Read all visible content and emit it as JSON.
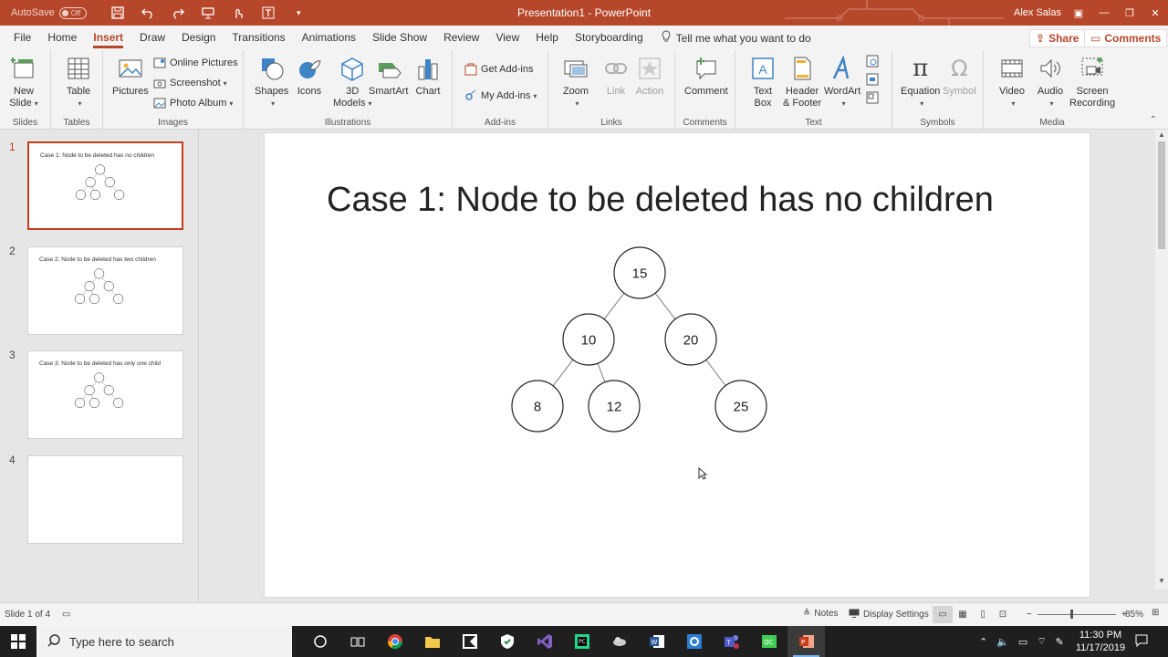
{
  "titlebar": {
    "autosave_label": "AutoSave",
    "autosave_state": "Off",
    "document_title": "Presentation1  -  PowerPoint",
    "user_name": "Alex Salas"
  },
  "tabs": [
    "File",
    "Home",
    "Insert",
    "Draw",
    "Design",
    "Transitions",
    "Animations",
    "Slide Show",
    "Review",
    "View",
    "Help",
    "Storyboarding"
  ],
  "active_tab": "Insert",
  "tell_me": "Tell me what you want to do",
  "share_label": "Share",
  "comments_label": "Comments",
  "ribbon": {
    "slides": {
      "label": "Slides",
      "new_slide_1": "New",
      "new_slide_2": "Slide"
    },
    "tables": {
      "label": "Tables",
      "table": "Table"
    },
    "images": {
      "label": "Images",
      "pictures": "Pictures",
      "online_pictures": "Online Pictures",
      "screenshot": "Screenshot",
      "photo_album": "Photo Album"
    },
    "illustrations": {
      "label": "Illustrations",
      "shapes": "Shapes",
      "icons": "Icons",
      "models_1": "3D",
      "models_2": "Models",
      "smartart": "SmartArt",
      "chart": "Chart"
    },
    "addins": {
      "label": "Add-ins",
      "get_addins": "Get Add-ins",
      "my_addins": "My Add-ins"
    },
    "links": {
      "label": "Links",
      "zoom": "Zoom",
      "link": "Link",
      "action": "Action"
    },
    "comments": {
      "label": "Comments",
      "comment": "Comment"
    },
    "text": {
      "label": "Text",
      "textbox_1": "Text",
      "textbox_2": "Box",
      "header_1": "Header",
      "header_2": "& Footer",
      "wordart": "WordArt"
    },
    "symbols": {
      "label": "Symbols",
      "equation": "Equation",
      "symbol": "Symbol"
    },
    "media": {
      "label": "Media",
      "video": "Video",
      "audio": "Audio",
      "screen_1": "Screen",
      "screen_2": "Recording"
    }
  },
  "thumbnails": [
    {
      "num": "1",
      "title": "Case 1: Node to be deleted has no children",
      "has_tree": true
    },
    {
      "num": "2",
      "title": "Case 2: Node to be deleted has two children",
      "has_tree": true
    },
    {
      "num": "3",
      "title": "Case 3: Node to be deleted has only one child",
      "has_tree": true
    },
    {
      "num": "4",
      "title": "",
      "has_tree": false
    }
  ],
  "slide": {
    "title": "Case 1: Node to be deleted has no children",
    "nodes": [
      {
        "id": "n15",
        "value": "15"
      },
      {
        "id": "n10",
        "value": "10"
      },
      {
        "id": "n20",
        "value": "20"
      },
      {
        "id": "n8",
        "value": "8"
      },
      {
        "id": "n12",
        "value": "12"
      },
      {
        "id": "n25",
        "value": "25"
      }
    ],
    "edges": [
      [
        "n15",
        "n10"
      ],
      [
        "n15",
        "n20"
      ],
      [
        "n10",
        "n8"
      ],
      [
        "n10",
        "n12"
      ],
      [
        "n20",
        "n25"
      ]
    ]
  },
  "statusbar": {
    "slide_info": "Slide 1 of 4",
    "notes": "Notes",
    "display_settings": "Display Settings",
    "zoom_level": "85%"
  },
  "taskbar": {
    "search_placeholder": "Type here to search",
    "time": "11:30 PM",
    "date": "11/17/2019"
  },
  "colors": {
    "accent": "#b7472a",
    "selected_border": "#c43e1c"
  }
}
